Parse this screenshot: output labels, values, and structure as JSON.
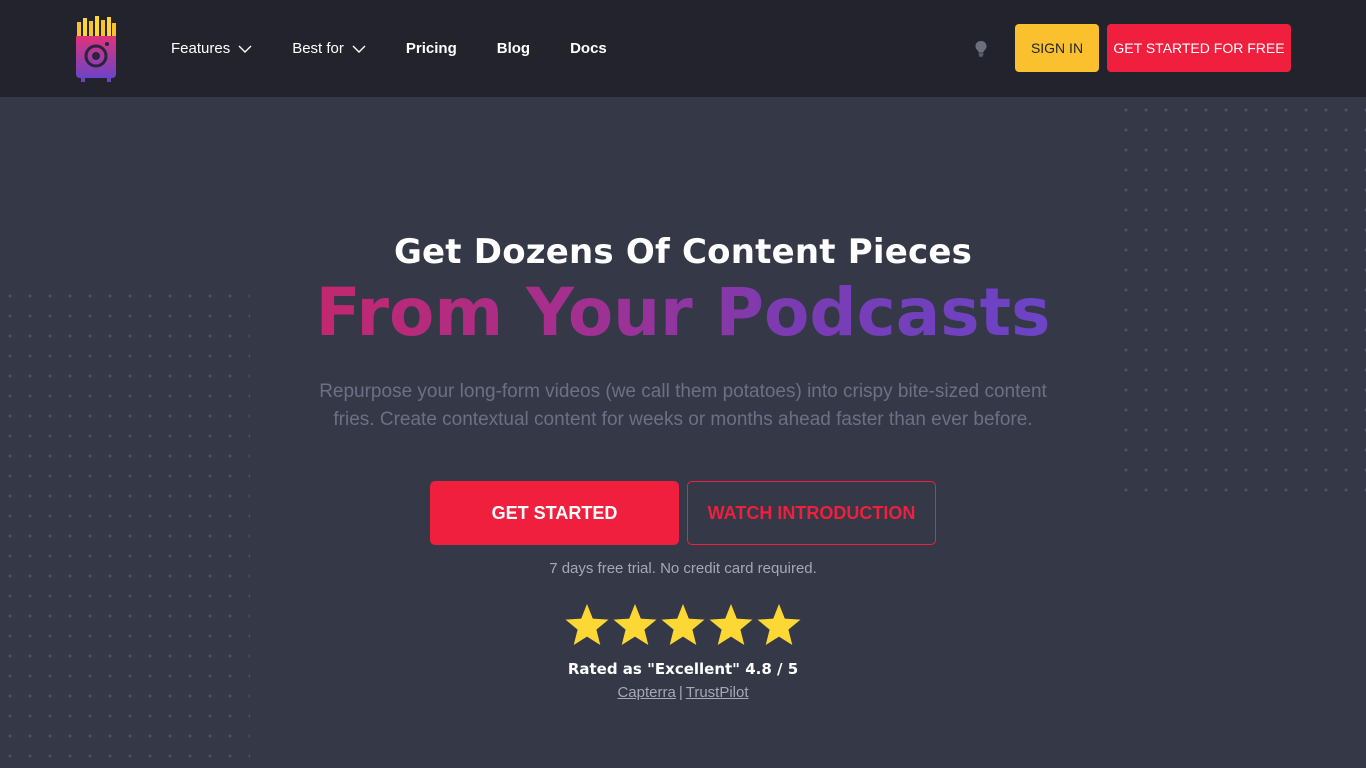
{
  "header": {
    "nav": [
      {
        "label": "Features",
        "has_dropdown": true
      },
      {
        "label": "Best for",
        "has_dropdown": true
      },
      {
        "label": "Pricing",
        "has_dropdown": false
      },
      {
        "label": "Blog",
        "has_dropdown": false
      },
      {
        "label": "Docs",
        "has_dropdown": false
      }
    ],
    "theme_toggle_icon": "lightbulb-icon",
    "sign_in_label": "SIGN IN",
    "get_started_free_label": "GET STARTED FOR FREE"
  },
  "hero": {
    "title_line1": "Get Dozens Of Content Pieces",
    "title_line2": "From Your Podcasts",
    "description": "Repurpose your long-form videos (we call them potatoes) into crispy bite-sized content fries. Create contextual content for weeks or months ahead faster than ever before.",
    "primary_button": "GET STARTED",
    "secondary_button": "WATCH INTRODUCTION",
    "trial_note": "7 days free trial. No credit card required.",
    "rating": {
      "stars": 5,
      "text": "Rated as \"Excellent\" 4.8 / 5",
      "sources": [
        "Capterra",
        "TrustPilot"
      ],
      "separator": "|"
    }
  },
  "colors": {
    "header_bg": "#22232c",
    "page_bg": "#343847",
    "accent_red": "#ef1f3d",
    "accent_yellow": "#fbc02d",
    "gradient_start": "#c2286e",
    "gradient_end": "#6b44c6",
    "star": "#fdd835"
  }
}
